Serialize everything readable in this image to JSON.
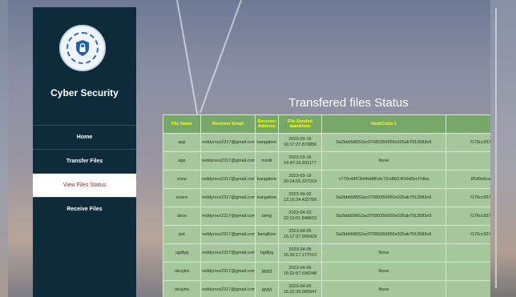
{
  "sidebar": {
    "logo_icon": "padlock-shield-icon",
    "brand_title": "Cyber Security",
    "nav": [
      {
        "label": "Home"
      },
      {
        "label": "Transfer Files"
      },
      {
        "label": "View Files Status",
        "active": true
      },
      {
        "label": "Receive Files"
      }
    ]
  },
  "main": {
    "title": "Transfered files Status",
    "table": {
      "headers": [
        "File Name",
        "Receiver Email",
        "Receiver Address",
        "File Sended date&time",
        "HashCode-1",
        ""
      ],
      "rows": [
        [
          "app",
          "reddyrocx2317@gmail.com",
          "bangalore",
          "2023-03-15 16:17:27.873856",
          "0a2bbb58652ac07089356950e326ab7913583e9",
          "f176cc937"
        ],
        [
          "app",
          "reddyrocx2317@gmail.com",
          "mzdk",
          "2023-03-15 16:47:16.831177",
          "None",
          ""
        ],
        [
          "vono",
          "reddyrocx2317@gmail.com",
          "bangalore",
          "2023-03-19 20:24:55.327319",
          "c770c44f73ef4dd8fcdc72cd9d14Odd5ecf7dba",
          "85d0e6ca"
        ],
        [
          "eoore",
          "reddyrocx2317@gmail.com",
          "bangalore",
          "2023-04-02 13:16:34.433750",
          "0a2bbb58652ac07089356950e326ab7913583e9",
          "f176cc937"
        ],
        [
          "docs",
          "reddyrocx2317@gmail.com",
          "beng",
          "2023-04-02 22:10:01.848810",
          "0a2bbb58652ac07089356950e326ab7913583e9",
          "f176cc937"
        ],
        [
          "pot",
          "reddyrocx2317@gmail.com",
          "bengllore",
          "2023-04-05 15:17:27.909429",
          "0a2bbb58652ac07089356950e326ab7913583e9",
          "f176cc937"
        ],
        [
          "ugdfyg",
          "reddyrocx2317@gmail.com",
          "hgdfyg",
          "2023-04-05 15:30:17.177510",
          "None",
          ""
        ],
        [
          "okuytre",
          "reddyrocx2317@gmail.com",
          "jgyjyj",
          "2023-04-05 15:31:57.596248",
          "None",
          ""
        ],
        [
          "okuytre",
          "reddyrocx2317@gmail.com",
          "jgyjyj",
          "2023-04-05 15:32:35.686947",
          "None",
          ""
        ]
      ]
    }
  }
}
